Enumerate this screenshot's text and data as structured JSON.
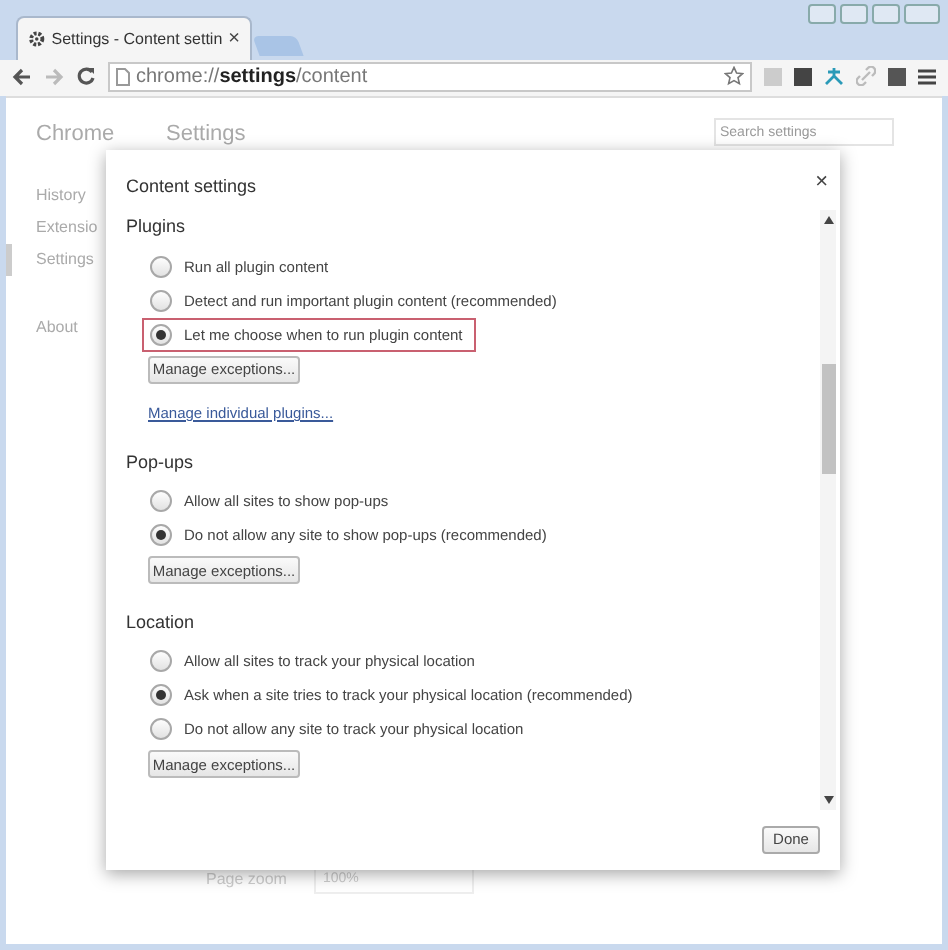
{
  "tab": {
    "title": "Settings - Content settin",
    "close": "×",
    "selected": true
  },
  "address": {
    "scheme": "chrome://",
    "host": "settings",
    "path": "/content"
  },
  "page": {
    "brand": "Chrome",
    "heading": "Settings",
    "search": {
      "placeholder": "Search settings"
    },
    "nav": [
      {
        "label": "History",
        "selected": false
      },
      {
        "label": "Extensio",
        "selected": false
      },
      {
        "label": "Settings",
        "selected": true
      },
      {
        "label": "About",
        "selected": false
      }
    ],
    "zoom": {
      "label": "Page zoom",
      "value": "100%"
    }
  },
  "dialog": {
    "title": "Content settings",
    "close": "×",
    "sections": [
      {
        "title": "Plugins",
        "options": [
          {
            "label": "Run all plugin content",
            "selected": false,
            "highlighted": false
          },
          {
            "label": "Detect and run important plugin content (recommended)",
            "selected": false,
            "highlighted": false
          },
          {
            "label": "Let me choose when to run plugin content",
            "selected": true,
            "highlighted": true
          }
        ],
        "button": "Manage exceptions...",
        "link": "Manage individual plugins..."
      },
      {
        "title": "Pop-ups",
        "options": [
          {
            "label": "Allow all sites to show pop-ups",
            "selected": false,
            "highlighted": false
          },
          {
            "label": "Do not allow any site to show pop-ups (recommended)",
            "selected": true,
            "highlighted": false
          }
        ],
        "button": "Manage exceptions..."
      },
      {
        "title": "Location",
        "options": [
          {
            "label": "Allow all sites to track your physical location",
            "selected": false,
            "highlighted": false
          },
          {
            "label": "Ask when a site tries to track your physical location (recommended)",
            "selected": true,
            "highlighted": false
          },
          {
            "label": "Do not allow any site to track your physical location",
            "selected": false,
            "highlighted": false
          }
        ],
        "button": "Manage exceptions..."
      }
    ],
    "done": "Done"
  }
}
